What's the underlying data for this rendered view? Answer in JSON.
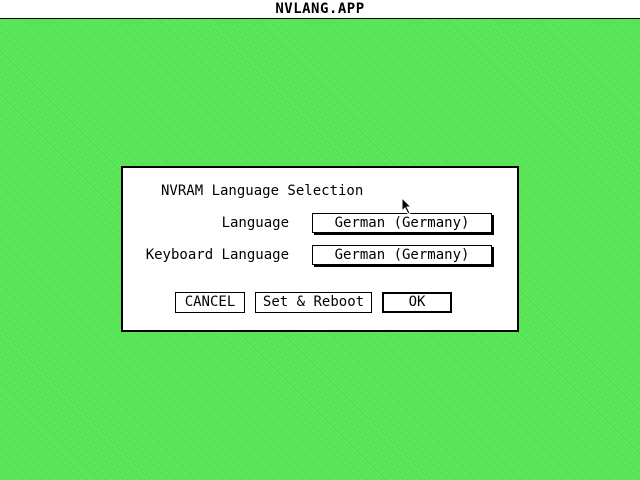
{
  "menubar": {
    "title": "NVLANG.APP"
  },
  "dialog": {
    "heading": "NVRAM Language Selection",
    "language_label": "Language",
    "language_value": "German (Germany)",
    "keyboard_label": "Keyboard Language",
    "keyboard_value": "German (Germany)",
    "buttons": {
      "cancel": "CANCEL",
      "set_reboot": "Set & Reboot",
      "ok": "OK"
    }
  },
  "colors": {
    "desktop": "#5ae85a",
    "window": "#ffffff",
    "ink": "#000000"
  },
  "icons": {
    "pointer": "arrow-pointer-icon"
  }
}
